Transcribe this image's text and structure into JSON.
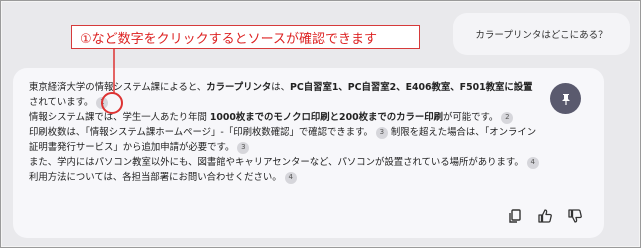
{
  "user_message": "カラープリンタはどこにある？",
  "annotation": "①など数字をクリックするとソースが確認できます",
  "answer": {
    "p1_a": "東京経済大学の情報システム課によると、",
    "p1_b": "カラープリンタ",
    "p1_c": "は、",
    "p1_d": "PC自習室1、PC自習室2、E406教室、F501教室に設置",
    "p1_e": "されています。",
    "cite1": "1",
    "p2_a": "情報システム課では、学生一人あたり年間 ",
    "p2_b": "1000枚までのモノクロ印刷と200枚までのカラー印刷",
    "p2_c": "が可能です。",
    "cite2": "2",
    "p3_a": "印刷枚数は、「情報システム課ホームページ」-「印刷枚数確認」で確認できます。",
    "cite3a": "3",
    "p3_b": " 制限を超えた場合は、「オンライン証明書発行サービス」から追加申請が必要です。",
    "cite3b": "3",
    "p4_a": "また、学内にはパソコン教室以外にも、図書館やキャリアセンターなど、パソコンが設置されている場所があります。",
    "cite4a": "4",
    "p4_b": "利用方法については、各担当部署にお問い合わせください。",
    "cite4b": "4"
  },
  "icons": {
    "pin": "pin-icon",
    "copy": "copy-icon",
    "like": "thumbs-up-icon",
    "dislike": "thumbs-down-icon"
  }
}
